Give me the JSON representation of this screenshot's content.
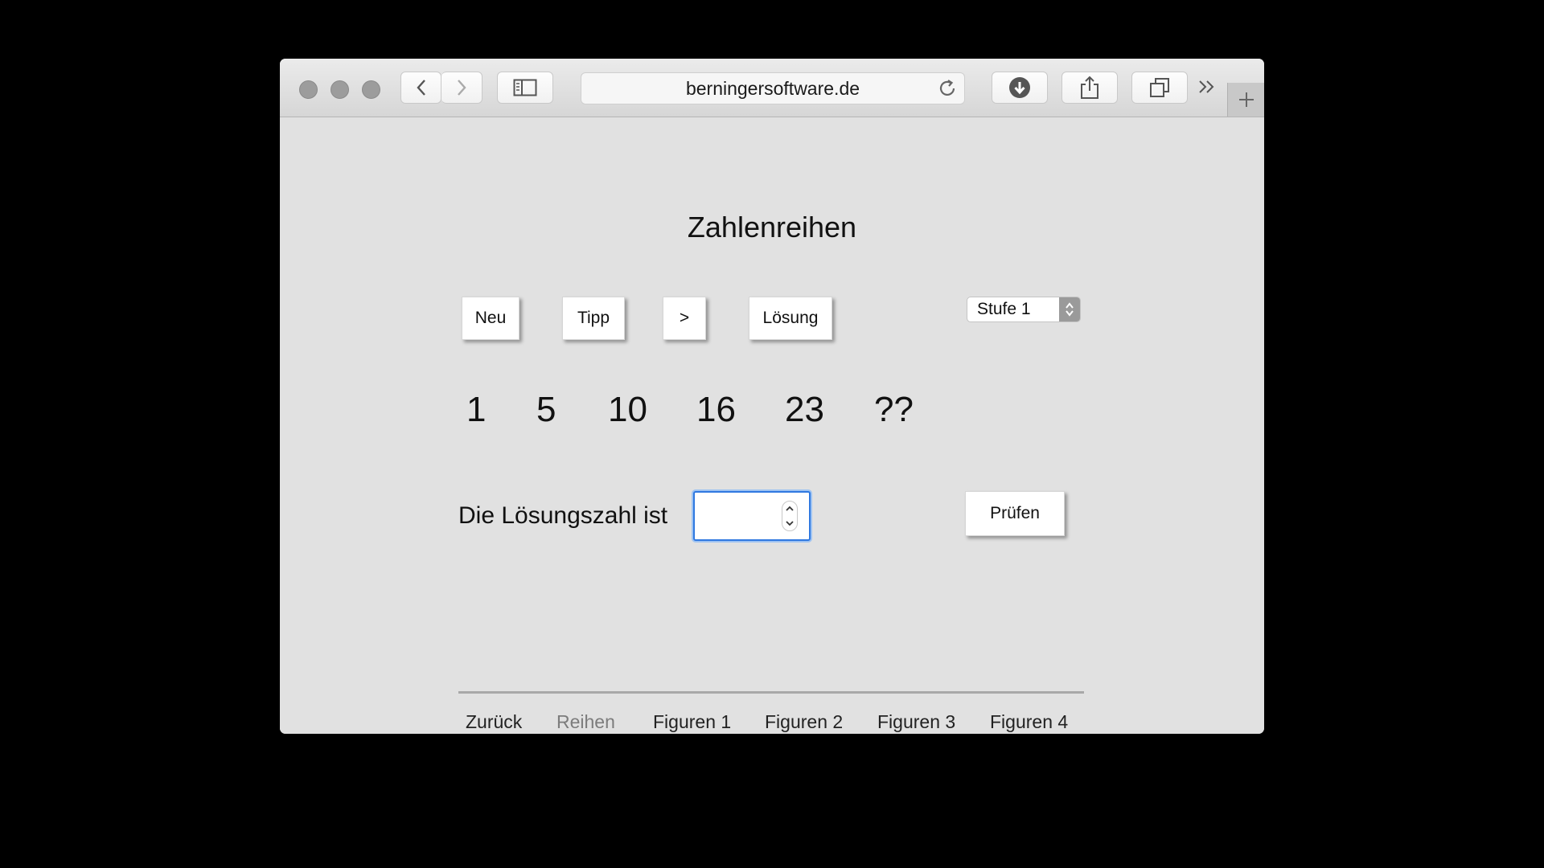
{
  "browser": {
    "url": "berningersoftware.de",
    "icons": {
      "back": "chevron-left-icon",
      "forward": "chevron-right-icon",
      "sidebar": "sidebar-icon",
      "reload": "reload-icon",
      "downloads": "download-icon",
      "share": "share-icon",
      "tabs": "tabs-overview-icon",
      "more": "double-chevron-icon",
      "new_tab": "plus-icon"
    }
  },
  "page": {
    "title": "Zahlenreihen",
    "buttons": {
      "new": "Neu",
      "hint": "Tipp",
      "next": ">",
      "solution": "Lösung",
      "check": "Prüfen"
    },
    "level_select": {
      "selected": "Stufe 1"
    },
    "sequence": [
      "1",
      "5",
      "10",
      "16",
      "23",
      "??"
    ],
    "answer": {
      "label": "Die Lösungszahl ist",
      "value": ""
    },
    "nav": {
      "items": [
        "Zurück",
        "Reihen",
        "Figuren 1",
        "Figuren 2",
        "Figuren 3",
        "Figuren 4"
      ],
      "current": "Reihen"
    }
  },
  "colors": {
    "background": "#000000",
    "page": "#e1e1e1",
    "focus": "#2f78e0",
    "nav_current": "#7c7c7c"
  }
}
